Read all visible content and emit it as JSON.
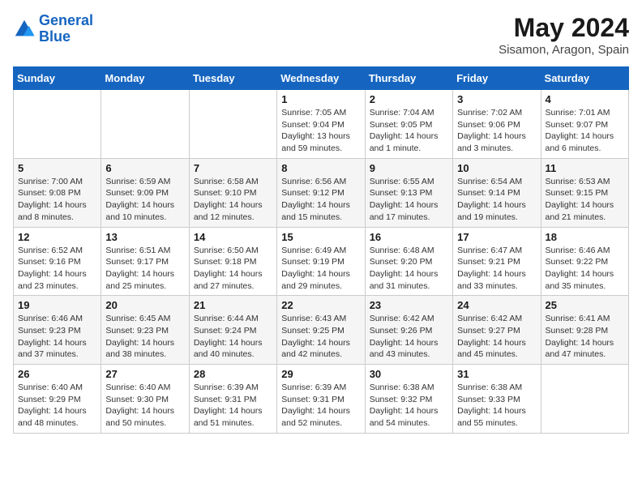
{
  "logo": {
    "line1": "General",
    "line2": "Blue"
  },
  "title": "May 2024",
  "location": "Sisamon, Aragon, Spain",
  "weekdays": [
    "Sunday",
    "Monday",
    "Tuesday",
    "Wednesday",
    "Thursday",
    "Friday",
    "Saturday"
  ],
  "weeks": [
    [
      {
        "day": "",
        "info": ""
      },
      {
        "day": "",
        "info": ""
      },
      {
        "day": "",
        "info": ""
      },
      {
        "day": "1",
        "info": "Sunrise: 7:05 AM\nSunset: 9:04 PM\nDaylight: 13 hours\nand 59 minutes."
      },
      {
        "day": "2",
        "info": "Sunrise: 7:04 AM\nSunset: 9:05 PM\nDaylight: 14 hours\nand 1 minute."
      },
      {
        "day": "3",
        "info": "Sunrise: 7:02 AM\nSunset: 9:06 PM\nDaylight: 14 hours\nand 3 minutes."
      },
      {
        "day": "4",
        "info": "Sunrise: 7:01 AM\nSunset: 9:07 PM\nDaylight: 14 hours\nand 6 minutes."
      }
    ],
    [
      {
        "day": "5",
        "info": "Sunrise: 7:00 AM\nSunset: 9:08 PM\nDaylight: 14 hours\nand 8 minutes."
      },
      {
        "day": "6",
        "info": "Sunrise: 6:59 AM\nSunset: 9:09 PM\nDaylight: 14 hours\nand 10 minutes."
      },
      {
        "day": "7",
        "info": "Sunrise: 6:58 AM\nSunset: 9:10 PM\nDaylight: 14 hours\nand 12 minutes."
      },
      {
        "day": "8",
        "info": "Sunrise: 6:56 AM\nSunset: 9:12 PM\nDaylight: 14 hours\nand 15 minutes."
      },
      {
        "day": "9",
        "info": "Sunrise: 6:55 AM\nSunset: 9:13 PM\nDaylight: 14 hours\nand 17 minutes."
      },
      {
        "day": "10",
        "info": "Sunrise: 6:54 AM\nSunset: 9:14 PM\nDaylight: 14 hours\nand 19 minutes."
      },
      {
        "day": "11",
        "info": "Sunrise: 6:53 AM\nSunset: 9:15 PM\nDaylight: 14 hours\nand 21 minutes."
      }
    ],
    [
      {
        "day": "12",
        "info": "Sunrise: 6:52 AM\nSunset: 9:16 PM\nDaylight: 14 hours\nand 23 minutes."
      },
      {
        "day": "13",
        "info": "Sunrise: 6:51 AM\nSunset: 9:17 PM\nDaylight: 14 hours\nand 25 minutes."
      },
      {
        "day": "14",
        "info": "Sunrise: 6:50 AM\nSunset: 9:18 PM\nDaylight: 14 hours\nand 27 minutes."
      },
      {
        "day": "15",
        "info": "Sunrise: 6:49 AM\nSunset: 9:19 PM\nDaylight: 14 hours\nand 29 minutes."
      },
      {
        "day": "16",
        "info": "Sunrise: 6:48 AM\nSunset: 9:20 PM\nDaylight: 14 hours\nand 31 minutes."
      },
      {
        "day": "17",
        "info": "Sunrise: 6:47 AM\nSunset: 9:21 PM\nDaylight: 14 hours\nand 33 minutes."
      },
      {
        "day": "18",
        "info": "Sunrise: 6:46 AM\nSunset: 9:22 PM\nDaylight: 14 hours\nand 35 minutes."
      }
    ],
    [
      {
        "day": "19",
        "info": "Sunrise: 6:46 AM\nSunset: 9:23 PM\nDaylight: 14 hours\nand 37 minutes."
      },
      {
        "day": "20",
        "info": "Sunrise: 6:45 AM\nSunset: 9:23 PM\nDaylight: 14 hours\nand 38 minutes."
      },
      {
        "day": "21",
        "info": "Sunrise: 6:44 AM\nSunset: 9:24 PM\nDaylight: 14 hours\nand 40 minutes."
      },
      {
        "day": "22",
        "info": "Sunrise: 6:43 AM\nSunset: 9:25 PM\nDaylight: 14 hours\nand 42 minutes."
      },
      {
        "day": "23",
        "info": "Sunrise: 6:42 AM\nSunset: 9:26 PM\nDaylight: 14 hours\nand 43 minutes."
      },
      {
        "day": "24",
        "info": "Sunrise: 6:42 AM\nSunset: 9:27 PM\nDaylight: 14 hours\nand 45 minutes."
      },
      {
        "day": "25",
        "info": "Sunrise: 6:41 AM\nSunset: 9:28 PM\nDaylight: 14 hours\nand 47 minutes."
      }
    ],
    [
      {
        "day": "26",
        "info": "Sunrise: 6:40 AM\nSunset: 9:29 PM\nDaylight: 14 hours\nand 48 minutes."
      },
      {
        "day": "27",
        "info": "Sunrise: 6:40 AM\nSunset: 9:30 PM\nDaylight: 14 hours\nand 50 minutes."
      },
      {
        "day": "28",
        "info": "Sunrise: 6:39 AM\nSunset: 9:31 PM\nDaylight: 14 hours\nand 51 minutes."
      },
      {
        "day": "29",
        "info": "Sunrise: 6:39 AM\nSunset: 9:31 PM\nDaylight: 14 hours\nand 52 minutes."
      },
      {
        "day": "30",
        "info": "Sunrise: 6:38 AM\nSunset: 9:32 PM\nDaylight: 14 hours\nand 54 minutes."
      },
      {
        "day": "31",
        "info": "Sunrise: 6:38 AM\nSunset: 9:33 PM\nDaylight: 14 hours\nand 55 minutes."
      },
      {
        "day": "",
        "info": ""
      }
    ]
  ]
}
